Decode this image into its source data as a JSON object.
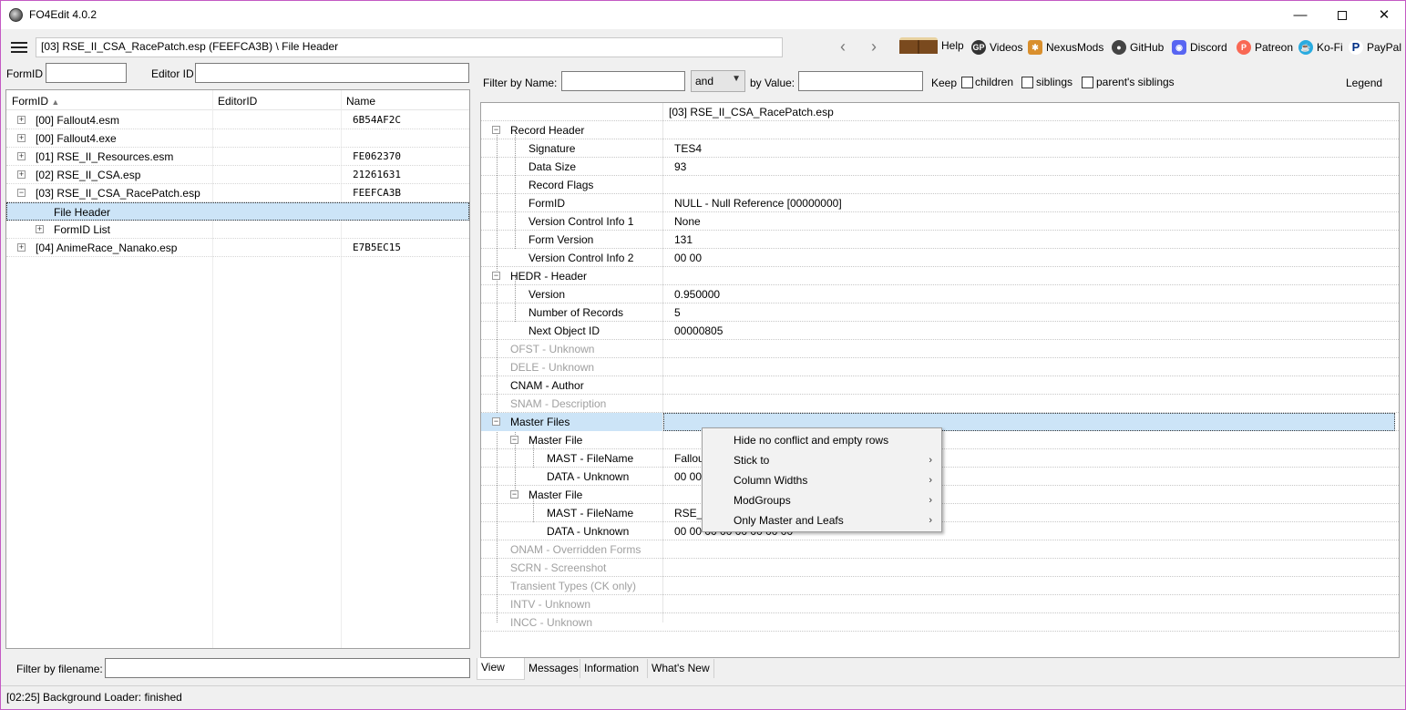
{
  "window": {
    "title": "FO4Edit 4.0.2"
  },
  "toolbar": {
    "path": "[03] RSE_II_CSA_RacePatch.esp (FEEFCA3B) \\ File Header",
    "back": "‹",
    "forward": "›",
    "links": {
      "help": "Help",
      "videos": "Videos",
      "nexusmods": "NexusMods",
      "github": "GitHub",
      "discord": "Discord",
      "patreon": "Patreon",
      "kofi": "Ko-Fi",
      "paypal": "PayPal"
    }
  },
  "left": {
    "formid_label": "FormID",
    "editorid_label": "Editor ID",
    "columns": {
      "formid": "FormID",
      "editorid": "EditorID",
      "name": "Name"
    },
    "rows": [
      {
        "label": "[00] Fallout4.esm",
        "hash": "6B54AF2C"
      },
      {
        "label": "[00] Fallout4.exe",
        "hash": ""
      },
      {
        "label": "[01] RSE_II_Resources.esm",
        "hash": "FE062370"
      },
      {
        "label": "[02] RSE_II_CSA.esp",
        "hash": "21261631"
      },
      {
        "label": "[03] RSE_II_CSA_RacePatch.esp",
        "hash": "FEEFCA3B"
      },
      {
        "label": "File Header",
        "hash": ""
      },
      {
        "label": "FormID List",
        "hash": ""
      },
      {
        "label": "[04] AnimeRace_Nanako.esp",
        "hash": "E7B5EC15"
      }
    ],
    "filter_filename_label": "Filter by filename:"
  },
  "right": {
    "filter_name_label": "Filter by Name:",
    "op_value": "and",
    "filter_value_label": "by Value:",
    "keep_label": "Keep",
    "children_label": "children",
    "siblings_label": "siblings",
    "parents_siblings_label": "parent's siblings",
    "legend_label": "Legend",
    "column_header": "[03] RSE_II_CSA_RacePatch.esp",
    "rows": [
      {
        "name": "Record Header",
        "value": ""
      },
      {
        "name": "Signature",
        "value": "TES4"
      },
      {
        "name": "Data Size",
        "value": "93"
      },
      {
        "name": "Record Flags",
        "value": ""
      },
      {
        "name": "FormID",
        "value": "NULL - Null Reference [00000000]"
      },
      {
        "name": "Version Control Info 1",
        "value": "None"
      },
      {
        "name": "Form Version",
        "value": "131"
      },
      {
        "name": "Version Control Info 2",
        "value": "00 00"
      },
      {
        "name": "HEDR - Header",
        "value": ""
      },
      {
        "name": "Version",
        "value": "0.950000"
      },
      {
        "name": "Number of Records",
        "value": "5"
      },
      {
        "name": "Next Object ID",
        "value": "00000805"
      },
      {
        "name": "OFST - Unknown",
        "value": ""
      },
      {
        "name": "DELE - Unknown",
        "value": ""
      },
      {
        "name": "CNAM - Author",
        "value": ""
      },
      {
        "name": "SNAM - Description",
        "value": ""
      },
      {
        "name": "Master Files",
        "value": ""
      },
      {
        "name": "Master File",
        "value": ""
      },
      {
        "name": "MAST - FileName",
        "value": "Fallou"
      },
      {
        "name": "DATA - Unknown",
        "value": "00 00"
      },
      {
        "name": "Master File",
        "value": ""
      },
      {
        "name": "MAST - FileName",
        "value": "RSE_II"
      },
      {
        "name": "DATA - Unknown",
        "value": "00 00 00 00 00 00 00 00"
      },
      {
        "name": "ONAM - Overridden Forms",
        "value": ""
      },
      {
        "name": "SCRN - Screenshot",
        "value": ""
      },
      {
        "name": "Transient Types (CK only)",
        "value": ""
      },
      {
        "name": "INTV - Unknown",
        "value": ""
      },
      {
        "name": "INCC - Unknown",
        "value": ""
      }
    ],
    "tabs": [
      "View",
      "Messages",
      "Information",
      "What's New"
    ]
  },
  "context_menu": {
    "items": [
      {
        "label": "Hide no conflict and empty rows",
        "submenu": ""
      },
      {
        "label": "Stick to",
        "submenu": "›"
      },
      {
        "label": "Column Widths",
        "submenu": "›"
      },
      {
        "label": "ModGroups",
        "submenu": "›"
      },
      {
        "label": "Only Master and Leafs",
        "submenu": "›"
      }
    ]
  },
  "status": {
    "text": "[02:25] Background Loader: finished"
  }
}
